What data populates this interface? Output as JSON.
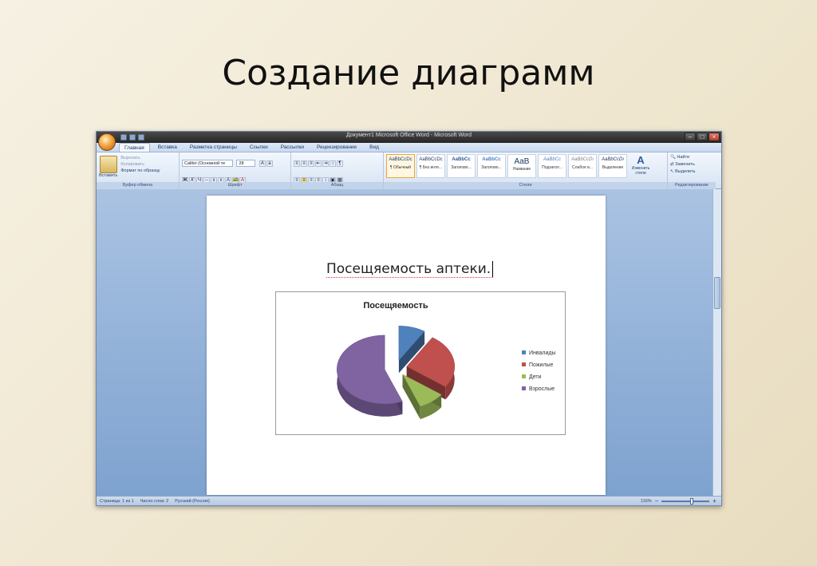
{
  "slide_title": "Создание диаграмм",
  "window": {
    "title": "Документ1 Microsoft Office Word - Microsoft Word",
    "tabs": [
      "Главная",
      "Вставка",
      "Разметка страницы",
      "Ссылки",
      "Рассылки",
      "Рецензирование",
      "Вид"
    ],
    "active_tab": "Главная"
  },
  "ribbon": {
    "clipboard": {
      "paste": "Вставить",
      "cut": "Вырезать",
      "copy": "Копировать",
      "format_painter": "Формат по образцу",
      "label": "Буфер обмена"
    },
    "font": {
      "name": "Calibri (Основной те",
      "size": "28",
      "label": "Шрифт"
    },
    "paragraph": {
      "label": "Абзац"
    },
    "styles": {
      "items": [
        {
          "sample": "AaBbCcDc",
          "name": "¶ Обычный"
        },
        {
          "sample": "AaBbCcDc",
          "name": "¶ Без инте..."
        },
        {
          "sample": "AaBbCc",
          "name": "Заголово..."
        },
        {
          "sample": "AaBbCc",
          "name": "Заголово..."
        },
        {
          "sample": "AaB",
          "name": "Название"
        },
        {
          "sample": "AaBbCc",
          "name": "Подзагол..."
        },
        {
          "sample": "AaBbCcDı",
          "name": "Слабое в..."
        },
        {
          "sample": "AaBbCcDı",
          "name": "Выделение"
        }
      ],
      "change": "Изменить стили",
      "label": "Стили"
    },
    "editing": {
      "find": "Найти",
      "replace": "Заменить",
      "select": "Выделить",
      "label": "Редактирование"
    }
  },
  "document": {
    "heading": "Посещяемость аптеки."
  },
  "chart_data": {
    "type": "pie",
    "title": "Посещяемость",
    "categories": [
      "Инвалиды",
      "Пожилые",
      "Дети",
      "Взрослые"
    ],
    "values": [
      9,
      26,
      9,
      56
    ],
    "colors": [
      "#4f81bd",
      "#c0504d",
      "#9bbb59",
      "#8064a2"
    ],
    "style": "3D exploded pie",
    "legend": "right"
  },
  "statusbar": {
    "page": "Страница: 1 из 1",
    "words": "Число слов: 2",
    "language": "Русский (Россия)",
    "zoom": "116%"
  }
}
